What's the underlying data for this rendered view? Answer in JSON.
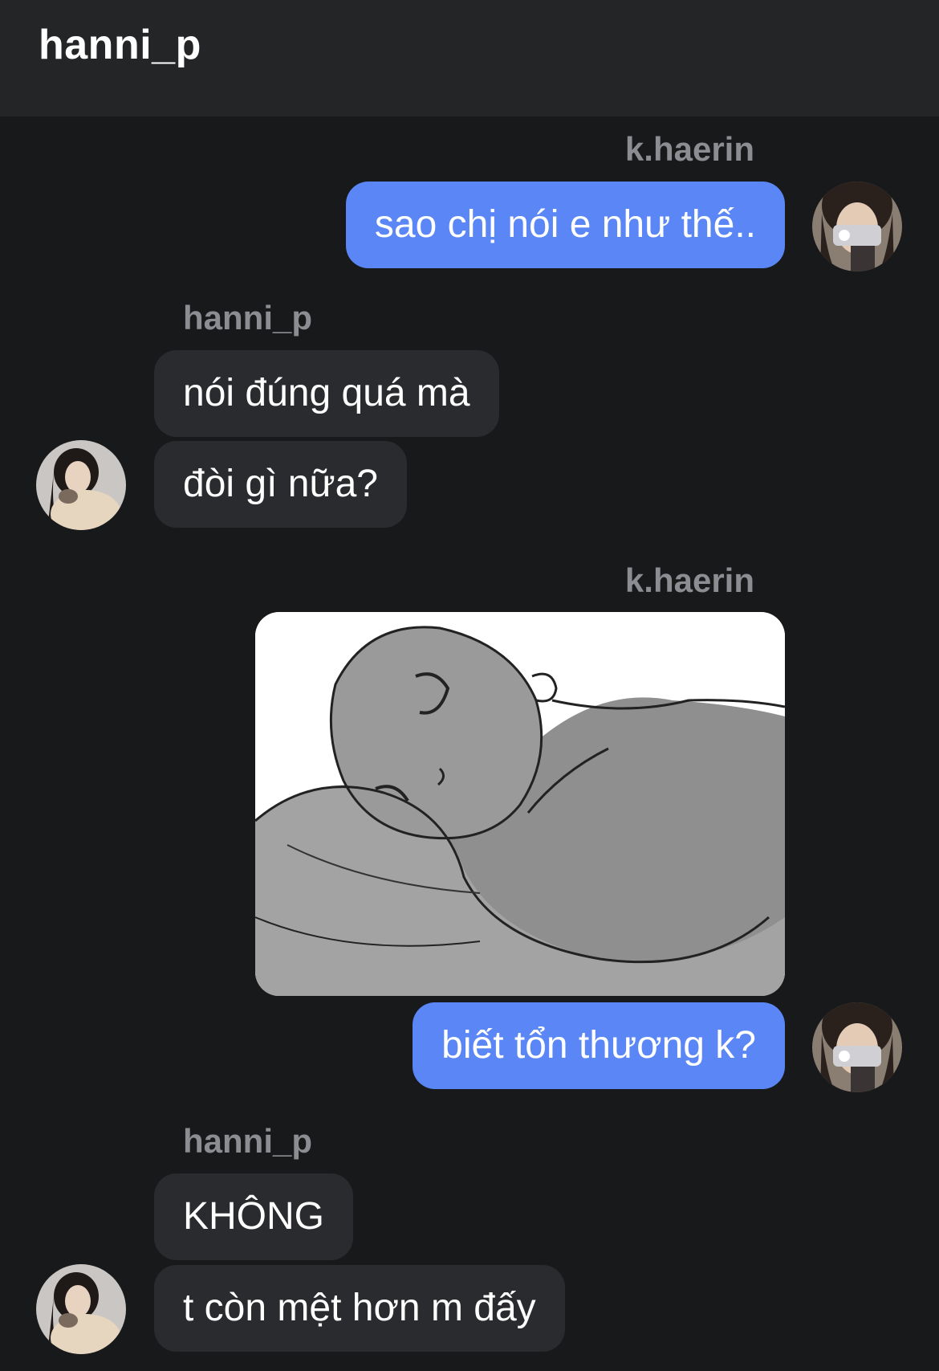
{
  "header": {
    "title": "hanni_p"
  },
  "messages": [
    {
      "sender": "k.haerin",
      "text": "sao chị nói e như thế.."
    },
    {
      "sender": "hanni_p",
      "texts": [
        "nói đúng quá mà",
        "đòi gì nữa?"
      ]
    },
    {
      "sender": "k.haerin",
      "image": "sketch of a person lying on a pillow",
      "text": "biết tổn thương k?"
    },
    {
      "sender": "hanni_p",
      "texts": [
        "KHÔNG",
        "t còn mệt hơn m đấy"
      ]
    }
  ],
  "colors": {
    "background": "#18191b",
    "header": "#242527",
    "outgoing_bubble": "#5b86f6",
    "incoming_bubble": "#2a2b2e",
    "sender_label": "#8b8d92"
  }
}
